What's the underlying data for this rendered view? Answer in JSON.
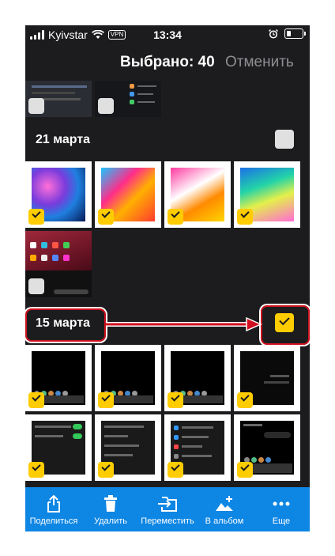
{
  "status_bar": {
    "carrier": "Kyivstar",
    "vpn": "VPN",
    "time": "13:34"
  },
  "header": {
    "title": "Выбрано: 40",
    "cancel": "Отменить"
  },
  "sections": [
    {
      "label": "21 марта",
      "all_selected": false
    },
    {
      "label": "15 марта",
      "all_selected": true
    }
  ],
  "toolbar": [
    {
      "label": "Поделиться",
      "icon": "share-icon"
    },
    {
      "label": "Удалить",
      "icon": "trash-icon"
    },
    {
      "label": "Переместить",
      "icon": "move-folder-icon"
    },
    {
      "label": "В альбом",
      "icon": "add-to-album-icon"
    },
    {
      "label": "Еще",
      "icon": "more-icon"
    }
  ],
  "colors": {
    "accent": "#ffcc00",
    "toolbar": "#0e86e4",
    "annotation": "#d0101e",
    "background": "#1c1c1e"
  }
}
